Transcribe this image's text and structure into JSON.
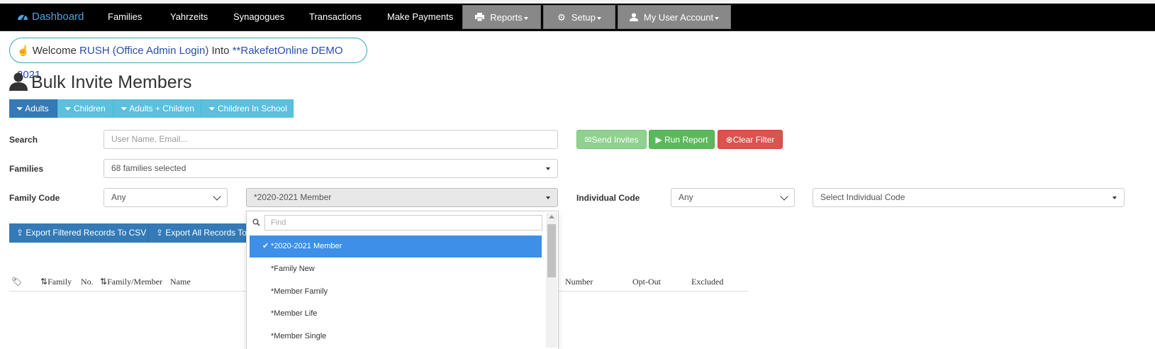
{
  "nav": {
    "brand": "Dashboard",
    "items": [
      "Families",
      "Yahrzeits",
      "Synagogues",
      "Transactions",
      "Make Payments"
    ],
    "reports": "Reports",
    "setup": "Setup",
    "account": "My User Account"
  },
  "welcome": {
    "prefix": "Welcome",
    "user": "RUSH (Office Admin Login)",
    "into": "Into",
    "org": "**RakefetOnline DEMO 2021"
  },
  "page": {
    "title": "Bulk Invite Members"
  },
  "tabs": [
    "Adults",
    "Children",
    "Adults + Children",
    "Children In School"
  ],
  "form": {
    "search_label": "Search",
    "search_placeholder": "User Name, Email...",
    "families_label": "Families",
    "families_value": "68 families selected",
    "family_code_label": "Family Code",
    "family_code_any": "Any",
    "family_code_value": "*2020-2021 Member",
    "individual_code_label": "Individual Code",
    "individual_code_any": "Any",
    "individual_code_placeholder": "Select Individual Code"
  },
  "buttons": {
    "send_invites": "Send Invites",
    "run_report": "Run Report",
    "clear_filter": "Clear Filter",
    "export_filtered": "Export Filtered Records To CSV",
    "export_all": "Export All Records To"
  },
  "table": {
    "headers": [
      "Family",
      "No.",
      "Family/Member",
      "Name",
      "Number",
      "Opt-Out",
      "Excluded"
    ]
  },
  "dropdown": {
    "find_placeholder": "Find",
    "options": [
      "*2020-2021 Member",
      "*Family New",
      "*Member Family",
      "*Member Life",
      "*Member Single"
    ],
    "selected_index": 0
  }
}
